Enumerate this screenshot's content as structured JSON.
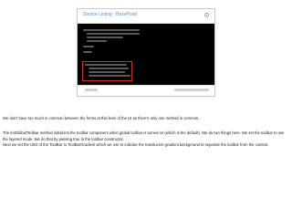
{
  "slide": {
    "title": "Source Listing - BasePoint",
    "footer_left": "",
    "footer_right": ""
  },
  "notes": {
    "line1": "We don't have too much in common between the forms at this level of the UI as there's only one method in common.",
    "line2": "The initGlobalToolbar method initializes the toolbar component when global toolbar is turned on (which is the default). We do two things here. We set the toolbar to use",
    "line3": "the layered mode. We do that by passing true to the toolbar constructor.",
    "line4": "Next we set the UIID of the ToolBar to ToolBarGradient which we use to indicate the translucent gradient background to separate the toolbar from the content."
  },
  "icons": {
    "slide_icon": "gear-icon"
  },
  "colors": {
    "title": "#5a8fd6",
    "highlight": "#d52a2a",
    "code_bg": "#000000"
  }
}
